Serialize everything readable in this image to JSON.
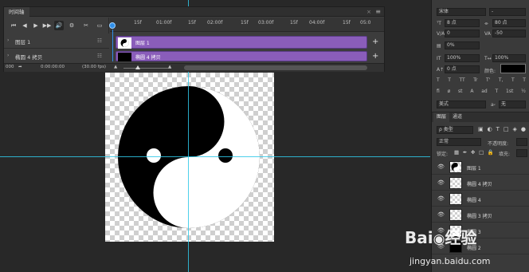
{
  "timeline": {
    "tab_label": "时间轴",
    "close_glyph": "×",
    "menu_glyph": "≡",
    "controls": [
      "⏮",
      "◀",
      "▶",
      "▶▶",
      "🔊",
      "⚙",
      "✂",
      "▭"
    ],
    "ruler_ticks": [
      "15f",
      "01:00f",
      "15f",
      "02:00f",
      "15f",
      "03:00f",
      "15f",
      "04:00f",
      "15f",
      "05:0"
    ],
    "layers": [
      {
        "name": "图层 1",
        "clip_label": "图层 1"
      },
      {
        "name": "椭圆 4 拷贝",
        "clip_label": "椭圆 4 拷贝"
      }
    ],
    "status_frame": "000",
    "status_time": "0:00:00:00",
    "status_fps": "(30.00 fps)"
  },
  "character": {
    "font_family_value": "宋体",
    "font_style_value": "-",
    "size_value": "8 点",
    "leading_value": "80 点",
    "kerning_label": "V/A",
    "kerning_value": "0",
    "tracking_value": "-50",
    "scale_value": "0%",
    "vscale_value": "100%",
    "hscale_value": "100%",
    "baseline_value": "0 点",
    "color_label": "颜色:",
    "style_buttons": [
      "T",
      "T",
      "TT",
      "Tr",
      "T'",
      "T,",
      "T",
      "T"
    ],
    "extra_buttons": [
      "fi",
      "ø",
      "st",
      "A",
      "ad",
      "T",
      "1st",
      "½"
    ],
    "language_value": "美式",
    "aa_value": "无",
    "color_hex": "#000000"
  },
  "layers_panel": {
    "tabs": [
      "图层",
      "通道"
    ],
    "filter_label": "ρ 类型",
    "blend_value": "正常",
    "opacity_label": "不透明度:",
    "lock_label": "锁定:",
    "fill_label": "填充:",
    "rows": [
      {
        "name": "图层 1"
      },
      {
        "name": "椭圆 4 拷贝"
      },
      {
        "name": "椭圆 4"
      },
      {
        "name": "椭圆 3 拷贝"
      },
      {
        "name": "椭圆 3"
      },
      {
        "name": "椭圆 2"
      }
    ]
  },
  "watermark": {
    "brand": "Bai",
    "brand_tail": "经验",
    "url": "jingyan.baidu.com"
  }
}
